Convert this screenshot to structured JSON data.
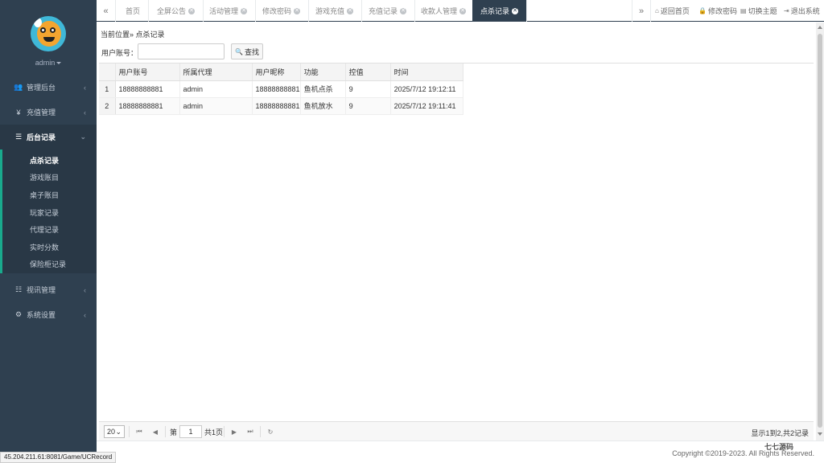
{
  "sidebar": {
    "username": "admin",
    "menu": [
      {
        "label": "管理后台",
        "icon": "users-icon",
        "glyph": "👥"
      },
      {
        "label": "充值管理",
        "icon": "yen-icon",
        "glyph": "¥"
      },
      {
        "label": "后台记录",
        "icon": "list-icon",
        "glyph": "☰"
      },
      {
        "label": "视讯管理",
        "icon": "columns-icon",
        "glyph": "☷"
      },
      {
        "label": "系统设置",
        "icon": "cogs-icon",
        "glyph": "⚙"
      }
    ],
    "submenu": [
      "点杀记录",
      "游戏账目",
      "桌子账目",
      "玩家记录",
      "代理记录",
      "实时分数",
      "保险柜记录"
    ]
  },
  "tabs": {
    "left_scroll": "«",
    "right_scroll": "»",
    "items": [
      "首页",
      "全屏公告",
      "活动管理",
      "修改密码",
      "游戏充值",
      "充值记录",
      "收款人管理",
      "点杀记录"
    ],
    "close_glyph": "✕"
  },
  "actions": {
    "home": "返回首页",
    "password": "修改密码",
    "theme": "切换主题",
    "logout": "退出系统"
  },
  "content": {
    "breadcrumb": "当前位置» 点杀记录",
    "search_label": "用户账号：",
    "search_value": "",
    "search_button": "查找",
    "table": {
      "headers": [
        "用户账号",
        "所属代理",
        "用户昵称",
        "功能",
        "控值",
        "时间"
      ],
      "rows": [
        {
          "n": "1",
          "account": "18888888881",
          "agent": "admin",
          "nickname": "18888888881",
          "func": "鱼机点杀",
          "value": "9",
          "time": "2025/7/12 19:12:11"
        },
        {
          "n": "2",
          "account": "18888888881",
          "agent": "admin",
          "nickname": "18888888881",
          "func": "鱼机放水",
          "value": "9",
          "time": "2025/7/12 19:11:41"
        }
      ]
    }
  },
  "pager": {
    "page_size": "20",
    "page_prefix": "第",
    "page_value": "1",
    "page_suffix": "共1页",
    "info": "显示1到2,共2记录"
  },
  "footer": {
    "copyright": "Copyright ©2019-2023. All Rights Reserved.",
    "watermark": "七七源码"
  },
  "status_url": "45.204.211.61:8081/Game/UCRecord",
  "colors": {
    "sidebar_bg": "#2f4050",
    "accent": "#19aa8d",
    "active_tab": "#2f4050"
  }
}
